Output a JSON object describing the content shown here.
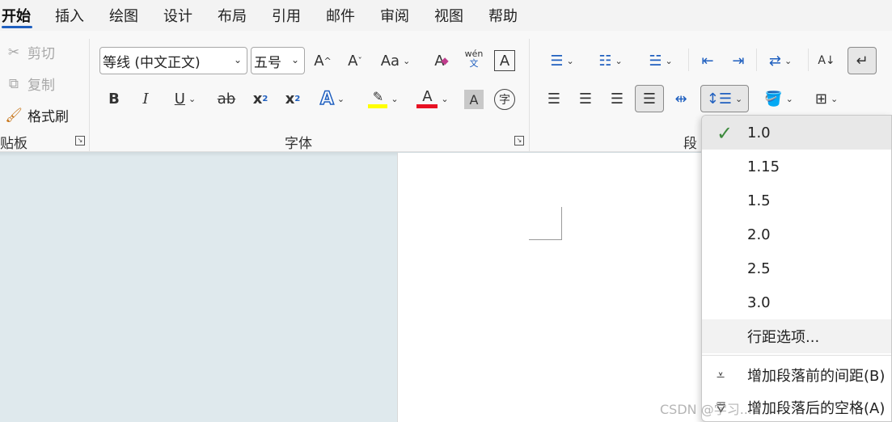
{
  "tabs": [
    "开始",
    "插入",
    "绘图",
    "设计",
    "布局",
    "引用",
    "邮件",
    "审阅",
    "视图",
    "帮助"
  ],
  "clipboard": {
    "cut": "剪切",
    "copy": "复制",
    "format_painter": "格式刷",
    "label": "贴板"
  },
  "font": {
    "name": "等线 (中文正文)",
    "size": "五号",
    "grow": "A",
    "shrink": "A",
    "change_case": "Aa",
    "clear": "A",
    "phonetic_top": "wén",
    "phonetic_bottom": "文",
    "border": "A",
    "bold": "B",
    "italic": "I",
    "underline": "U",
    "strike": "ab",
    "subscript": "x",
    "superscript": "x",
    "effects": "A",
    "font_color": "A",
    "shading": "A",
    "enclose": "字",
    "label": "字体"
  },
  "paragraph": {
    "label": "段"
  },
  "colors": {
    "accent": "#1f5fbf",
    "highlight": "#ffff00",
    "font_color": "#e81123",
    "check": "#3d8a3d"
  },
  "line_spacing_menu": {
    "options": [
      "1.0",
      "1.15",
      "1.5",
      "2.0",
      "2.5",
      "3.0"
    ],
    "selected": "1.0",
    "line_options": "行距选项...",
    "add_before": "增加段落前的间距(B)",
    "add_after": "增加段落后的空格(A)"
  },
  "watermark": "CSDN @学习..."
}
